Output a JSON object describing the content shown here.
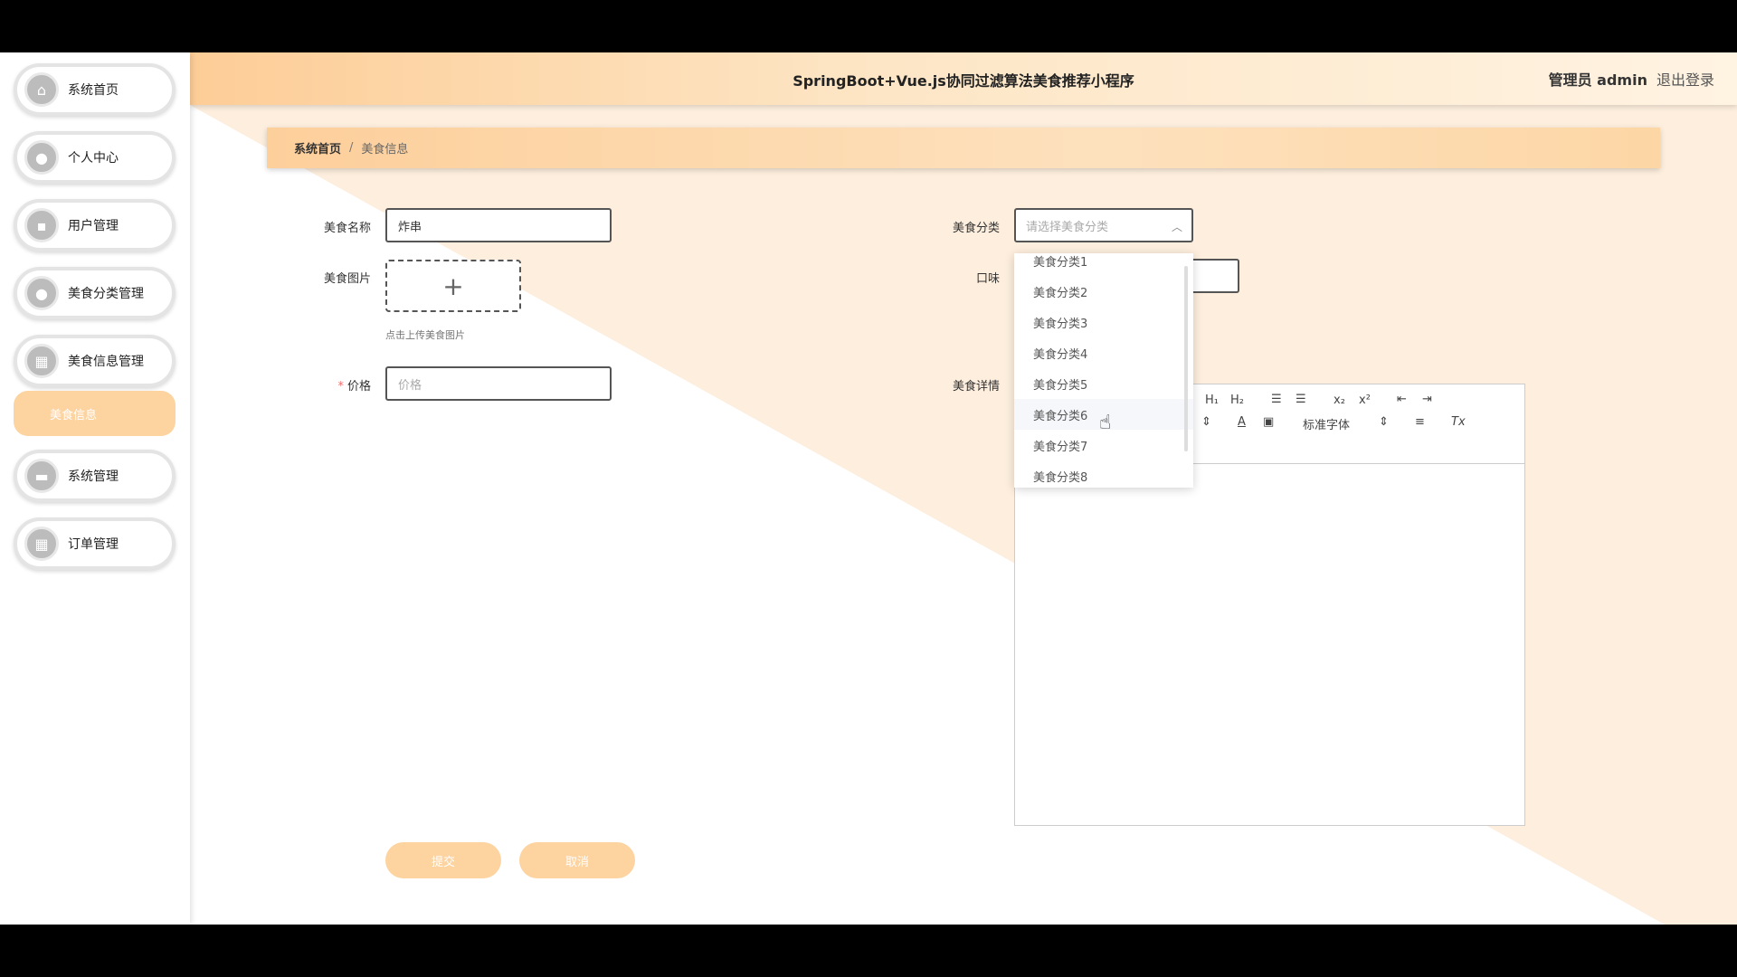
{
  "sidebar": {
    "items": [
      {
        "label": "系统首页",
        "icon": "home-icon"
      },
      {
        "label": "个人中心",
        "icon": "user-icon"
      },
      {
        "label": "用户管理",
        "icon": "chat-icon"
      },
      {
        "label": "美食分类管理",
        "icon": "user-icon"
      },
      {
        "label": "美食信息管理",
        "icon": "grid-icon"
      },
      {
        "label": "系统管理",
        "icon": "briefcase-icon"
      },
      {
        "label": "订单管理",
        "icon": "grid-icon"
      }
    ],
    "active_sub": "美食信息"
  },
  "header": {
    "title": "SpringBoot+Vue.js协同过滤算法美食推荐小程序",
    "user_role": "管理员 admin",
    "logout": "退出登录"
  },
  "breadcrumb": {
    "home": "系统首页",
    "separator": "/",
    "current": "美食信息"
  },
  "form": {
    "name_label": "美食名称",
    "name_value": "炸串",
    "image_label": "美食图片",
    "upload_hint": "点击上传美食图片",
    "price_required": "*",
    "price_label": "价格",
    "price_placeholder": "价格",
    "category_label": "美食分类",
    "category_placeholder": "请选择美食分类",
    "taste_label": "口味",
    "detail_label": "美食详情",
    "submit": "提交",
    "cancel": "取消"
  },
  "editor": {
    "h1": "H₁",
    "h2": "H₂",
    "sub": "x₂",
    "sup": "x²",
    "font": "标准字体",
    "clear": "Tx"
  },
  "dropdown": {
    "options": [
      "美食分类1",
      "美食分类2",
      "美食分类3",
      "美食分类4",
      "美食分类5",
      "美食分类6",
      "美食分类7",
      "美食分类8"
    ],
    "hovered": "美食分类6"
  },
  "colors": {
    "accent": "#fdd3a0",
    "header_start": "#fdcd97",
    "background_tint": "#fdeedd"
  }
}
